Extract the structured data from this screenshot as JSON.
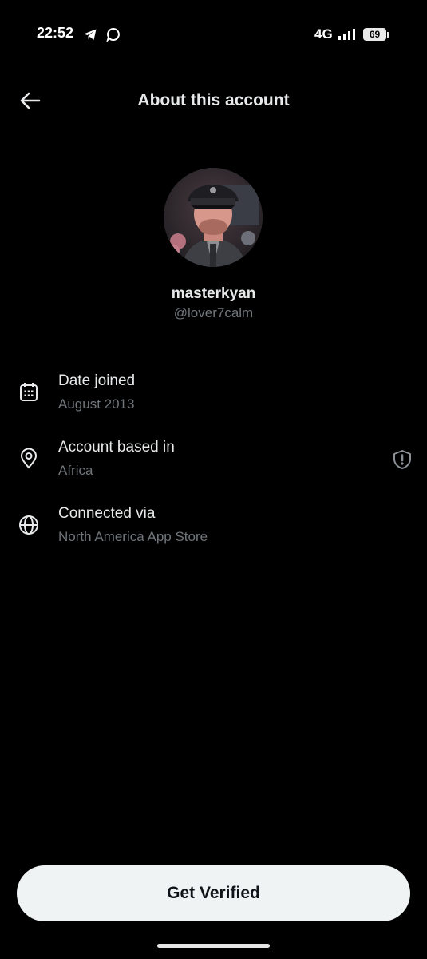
{
  "status_bar": {
    "time": "22:52",
    "network": "4G",
    "battery": "69",
    "icons": [
      "telegram-icon",
      "chat-bubble-icon",
      "signal-icon",
      "battery-icon"
    ]
  },
  "header": {
    "title": "About this account",
    "back_icon": "arrow-left-icon"
  },
  "profile": {
    "display_name": "masterkyan",
    "handle": "@lover7calm",
    "avatar_icon": "profile-photo"
  },
  "info_rows": [
    {
      "icon": "calendar-icon",
      "label": "Date joined",
      "value": "August 2013"
    },
    {
      "icon": "location-pin-icon",
      "label": "Account based in",
      "value": "Africa"
    },
    {
      "icon": "globe-icon",
      "label": "Connected via",
      "value": "North America App Store"
    }
  ],
  "location_notice_icon": "shield-alert-icon",
  "cta": {
    "label": "Get Verified"
  },
  "colors": {
    "background": "#000000",
    "text_primary": "#e7e9ea",
    "text_secondary": "#71767b",
    "button_bg": "#eff3f4",
    "button_text": "#0f1419"
  }
}
